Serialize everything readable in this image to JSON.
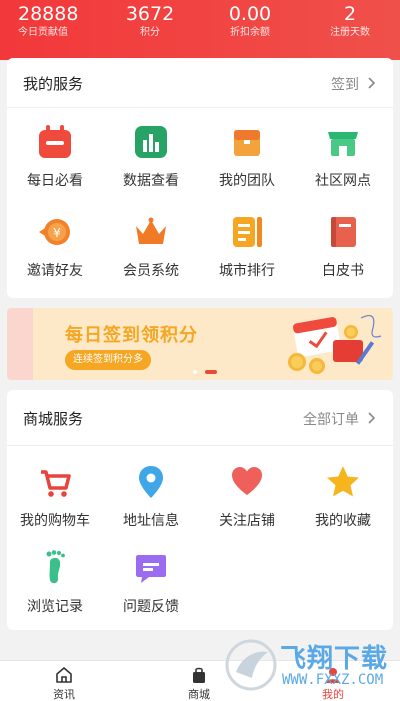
{
  "header": {
    "stats": [
      {
        "value": "28888",
        "label": "今日贡献值"
      },
      {
        "value": "3672",
        "label": "积分"
      },
      {
        "value": "0.00",
        "label": "折扣余额"
      },
      {
        "value": "2",
        "label": "注册天数"
      }
    ]
  },
  "services": {
    "title": "我的服务",
    "link": "签到",
    "items": [
      {
        "label": "每日必看",
        "icon": "calendar-icon"
      },
      {
        "label": "数据查看",
        "icon": "bar-chart-icon"
      },
      {
        "label": "我的团队",
        "icon": "box-icon"
      },
      {
        "label": "社区网点",
        "icon": "store-icon"
      },
      {
        "label": "邀请好友",
        "icon": "coin-icon"
      },
      {
        "label": "会员系统",
        "icon": "crown-icon"
      },
      {
        "label": "城市排行",
        "icon": "list-icon"
      },
      {
        "label": "白皮书",
        "icon": "book-icon"
      }
    ]
  },
  "banner": {
    "title": "每日签到领积分",
    "subtitle": "连续签到积分多"
  },
  "mall": {
    "title": "商城服务",
    "link": "全部订单",
    "items": [
      {
        "label": "我的购物车",
        "icon": "cart-icon"
      },
      {
        "label": "地址信息",
        "icon": "location-pin-icon"
      },
      {
        "label": "关注店铺",
        "icon": "heart-icon"
      },
      {
        "label": "我的收藏",
        "icon": "star-icon"
      },
      {
        "label": "浏览记录",
        "icon": "footprint-icon"
      },
      {
        "label": "问题反馈",
        "icon": "message-icon"
      }
    ]
  },
  "tabbar": {
    "tabs": [
      {
        "label": "资讯",
        "icon": "home-icon"
      },
      {
        "label": "商城",
        "icon": "shopping-bag-icon"
      },
      {
        "label": "我的",
        "icon": "user-icon",
        "active": true
      }
    ]
  },
  "watermark": {
    "text": "飞翔下载",
    "sub": "WWW.FXXZ.COM"
  },
  "colors": {
    "header": "#f2383a",
    "banner_bg": "#fde9c8",
    "banner_accent": "#f5a623",
    "active_tab": "#e8443a"
  }
}
